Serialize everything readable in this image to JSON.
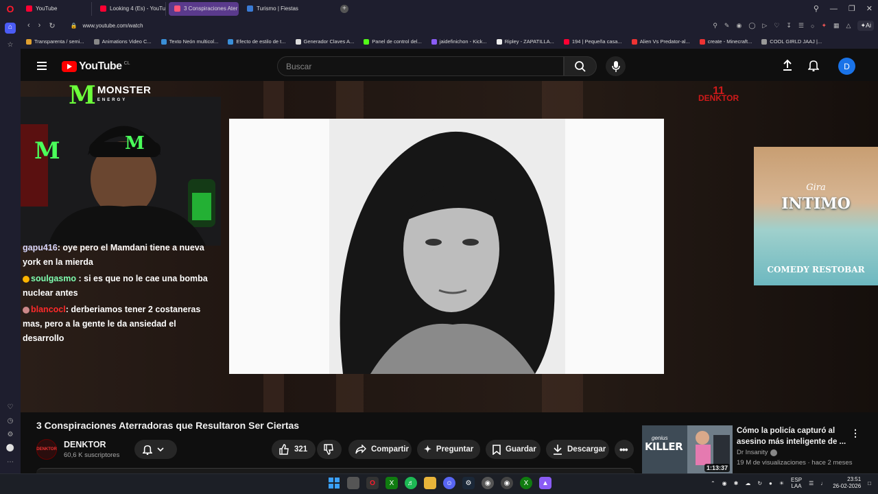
{
  "browser": {
    "tabs": [
      {
        "label": "YouTube"
      },
      {
        "label": "Looking 4 (Es) - YouTube"
      },
      {
        "label": "3 Conspiraciones Ater"
      },
      {
        "label": "Turismo | Fiestas"
      }
    ],
    "new_tab": "+",
    "url": "www.youtube.com/watch",
    "ai_label": "Ai",
    "bookmarks": [
      "Transparenta / semi...",
      "Animations Video C...",
      "Texto Neón multicol...",
      "Efecto de estilo de t...",
      "Generador Claves A...",
      "Panel de control del...",
      "jaidefinichon - Kick...",
      "Ripley - ZAPATILLA...",
      "194 | Pequeña casa...",
      "Alien Vs Predator-al...",
      "create - Minecraft...",
      "COOL GIRLD JAAJ |..."
    ]
  },
  "youtube": {
    "logo_text": "YouTube",
    "region": "CL",
    "search_placeholder": "Buscar",
    "avatar_letter": "D",
    "video": {
      "title": "3 Conspiraciones Aterradoras que Resultaron Ser Ciertas",
      "overlay": {
        "monster_brand": "MONSTER",
        "monster_sub": "ENERGY",
        "streamer_logo": "DENKTOR",
        "poster_top": "Gira",
        "poster_title": "INTIMO",
        "poster_bottom": "COMEDY RESTOBAR"
      },
      "chat": [
        {
          "user": "gapu416",
          "text": ": oye pero el Mamdani tiene a nueva york en la mierda"
        },
        {
          "user": "soulgasmo",
          "text": ": si es que no le cae una bomba nuclear antes"
        },
        {
          "user": "blancocl",
          "text": ": derberiamos tener 2 costaneras mas, pero a la gente le da ansiedad el desarrollo"
        }
      ]
    },
    "channel": {
      "name": "DENKTOR",
      "subscribers": "60,6 K suscriptores",
      "avatar_text": "DENKTOR"
    },
    "actions": {
      "likes": "321",
      "share": "Compartir",
      "ask": "Preguntar",
      "save": "Guardar",
      "download": "Descargar"
    },
    "recommended": {
      "title": "Cómo la policía capturó al asesino más inteligente de ...",
      "channel": "Dr Insanity",
      "meta": "19 M de visualizaciones · hace 2 meses",
      "duration": "1:13:37",
      "thumb_small": "genius",
      "thumb_big": "KILLER"
    }
  },
  "taskbar": {
    "lang_top": "ESP",
    "lang_bottom": "LAA",
    "time": "23:51",
    "date": "26-02-2026"
  }
}
